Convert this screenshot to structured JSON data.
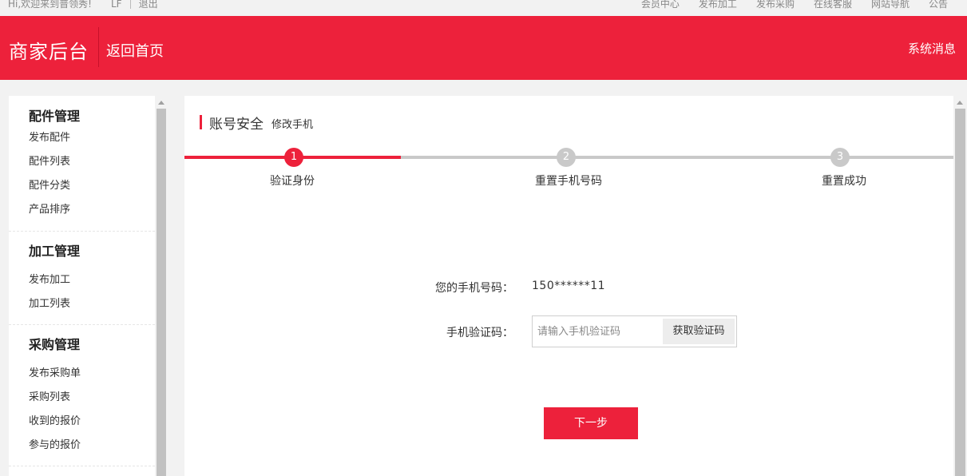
{
  "topbar": {
    "greeting": "Hi,欢迎来到普领秀!",
    "username": "LF",
    "logout": "退出",
    "links": [
      "会员中心",
      "发布加工",
      "发布采购",
      "在线客服",
      "网站导航",
      "公告"
    ]
  },
  "header": {
    "brand": "商家后台",
    "home": "返回首页",
    "messages": "系统消息"
  },
  "sidebar": {
    "groups": [
      {
        "title": "配件管理",
        "items": [
          "发布配件",
          "配件列表",
          "配件分类",
          "产品排序"
        ]
      },
      {
        "title": "加工管理",
        "items": [
          "发布加工",
          "加工列表"
        ]
      },
      {
        "title": "采购管理",
        "items": [
          "发布采购单",
          "采购列表",
          "收到的报价",
          "参与的报价"
        ]
      }
    ]
  },
  "main": {
    "title": "账号安全",
    "subtitle": "修改手机",
    "steps": [
      {
        "num": "1",
        "label": "验证身份",
        "state": "active"
      },
      {
        "num": "2",
        "label": "重置手机号码",
        "state": "todo"
      },
      {
        "num": "3",
        "label": "重置成功",
        "state": "todo"
      }
    ],
    "phone_label": "您的手机号码：",
    "phone_value": "150******11",
    "code_label": "手机验证码：",
    "code_placeholder": "请输入手机验证码",
    "code_button": "获取验证码",
    "next_button": "下一步"
  },
  "colors": {
    "accent": "#ed213b",
    "inactive": "#c9c9c9"
  }
}
